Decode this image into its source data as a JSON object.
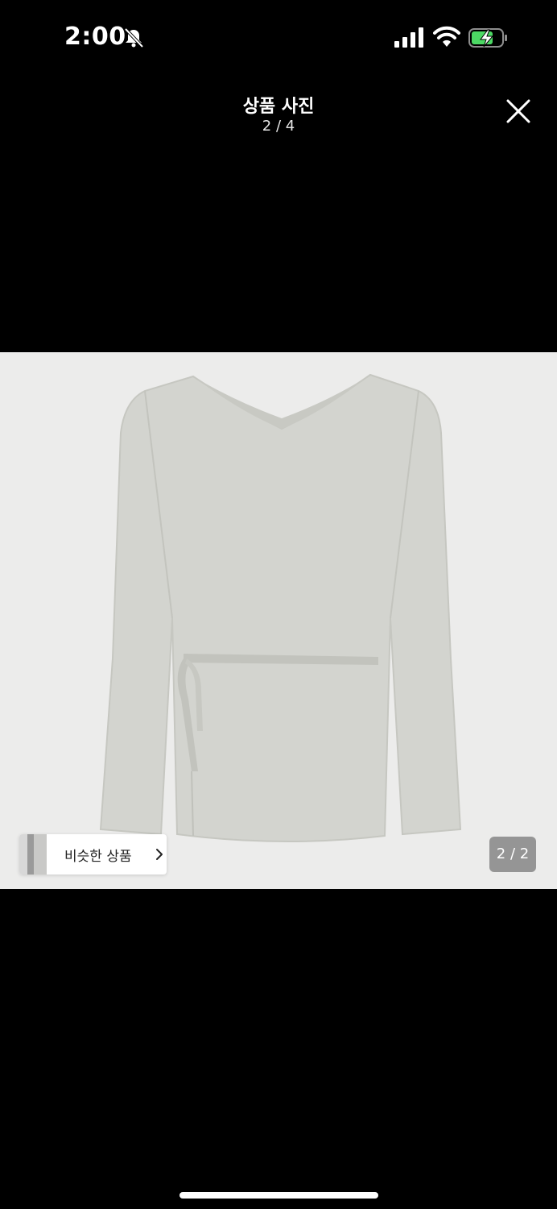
{
  "status_bar": {
    "time": "2:00",
    "icons": [
      "bell-slash-icon",
      "signal-icon",
      "wifi-icon",
      "battery-charging-icon"
    ],
    "battery_color": "#4cd964"
  },
  "header": {
    "title": "상품 사진",
    "counter": "2 / 4",
    "close_icon": "close-icon"
  },
  "photo": {
    "background": "#ececeb",
    "garment_color": "#d2d3ce",
    "similar_button_label": "비슷한 상품",
    "image_counter": "2 / 2"
  }
}
